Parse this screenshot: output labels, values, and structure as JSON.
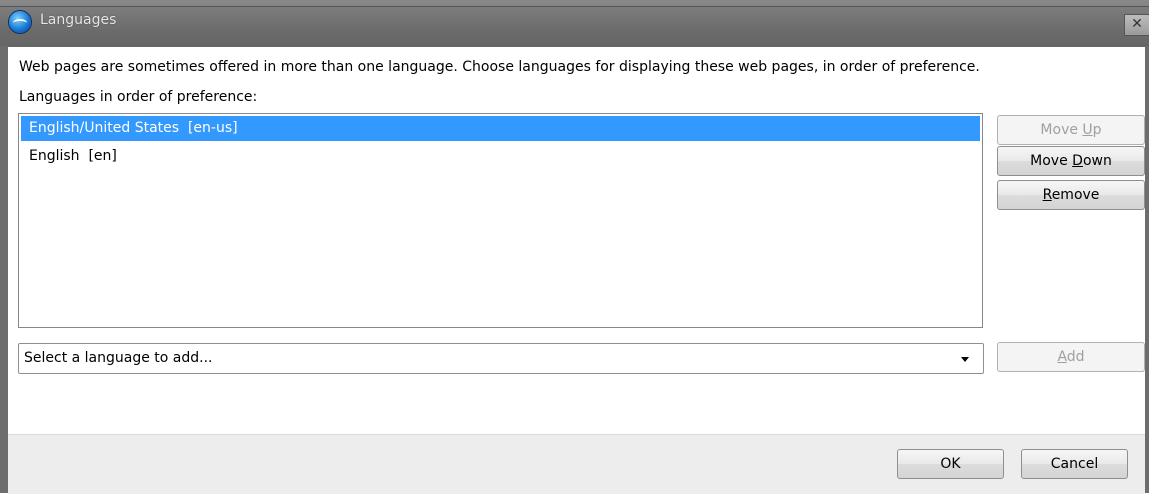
{
  "window": {
    "title": "Languages",
    "close_label": "✕"
  },
  "description": "Web pages are sometimes offered in more than one language. Choose languages for displaying these web pages, in order of preference.",
  "list_label": "Languages in order of preference:",
  "languages": [
    {
      "label": "English/United States  [en-us]",
      "selected": true
    },
    {
      "label": "English  [en]",
      "selected": false
    }
  ],
  "buttons": {
    "move_up": {
      "pre": "Move ",
      "accel": "U",
      "post": "p",
      "enabled": false
    },
    "move_down": {
      "pre": "Move ",
      "accel": "D",
      "post": "own",
      "enabled": true
    },
    "remove": {
      "pre": "",
      "accel": "R",
      "post": "emove",
      "enabled": true
    },
    "add": {
      "pre": "",
      "accel": "A",
      "post": "dd",
      "enabled": false
    },
    "ok": "OK",
    "cancel": "Cancel"
  },
  "language_select": {
    "placeholder": "Select a language to add..."
  },
  "icons": {
    "app": "browser-logo-icon",
    "close": "close-icon",
    "dropdown": "chevron-down-icon"
  },
  "colors": {
    "selection": "#3399ff",
    "titlebar": "#6d6d6d",
    "footer": "#ededed"
  }
}
